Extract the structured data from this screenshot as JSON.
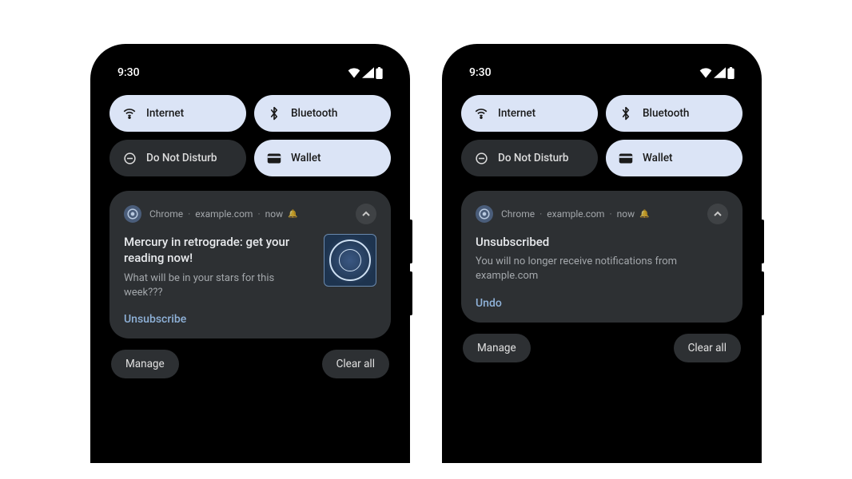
{
  "status": {
    "time": "9:30"
  },
  "quick_settings": {
    "internet": "Internet",
    "bluetooth": "Bluetooth",
    "dnd": "Do Not Disturb",
    "wallet": "Wallet"
  },
  "notification_a": {
    "app": "Chrome",
    "site": "example.com",
    "time": "now",
    "title": "Mercury in retrograde: get your reading now!",
    "subtitle": "What will be in your stars for this week???",
    "action": "Unsubscribe"
  },
  "notification_b": {
    "app": "Chrome",
    "site": "example.com",
    "time": "now",
    "title": "Unsubscribed",
    "subtitle": "You will no longer receive notifications from example.com",
    "action": "Undo"
  },
  "footer": {
    "manage": "Manage",
    "clear_all": "Clear all"
  }
}
